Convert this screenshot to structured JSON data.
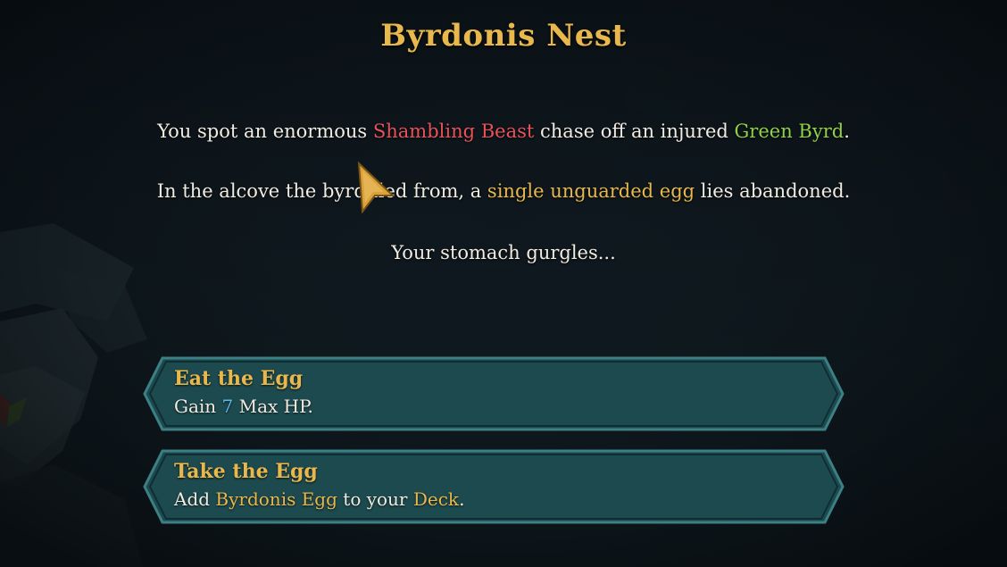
{
  "event": {
    "title": "Byrdonis Nest",
    "line1": {
      "a": "You spot an enormous ",
      "beast": "Shambling Beast",
      "b": " chase off an injured ",
      "byrd": "Green Byrd",
      "c": "."
    },
    "line2": {
      "a": "In the alcove the byrd",
      "hidden": " fled",
      "b": " from, a ",
      "egg": "single unguarded egg",
      "c": " lies abandoned."
    },
    "line3": "Your stomach gurgles..."
  },
  "options": [
    {
      "title": "Eat the Egg",
      "desc_a": "Gain ",
      "desc_num": "7",
      "desc_b": " Max HP."
    },
    {
      "title": "Take the Egg",
      "desc_a": "Add ",
      "desc_card": "Byrdonis Egg",
      "desc_b": " to your ",
      "desc_deck": "Deck",
      "desc_c": "."
    }
  ],
  "colors": {
    "title_gold": "#e9b84d",
    "text": "#f1ece2",
    "keyword_red": "#e8535a",
    "keyword_green": "#8fd14a",
    "keyword_gold": "#e9b84d",
    "number_blue": "#62b6e8",
    "option_fill": "#1d4a4f",
    "option_border": "#3c7f84"
  },
  "icons": {
    "cursor": "arrow-cursor-icon"
  }
}
